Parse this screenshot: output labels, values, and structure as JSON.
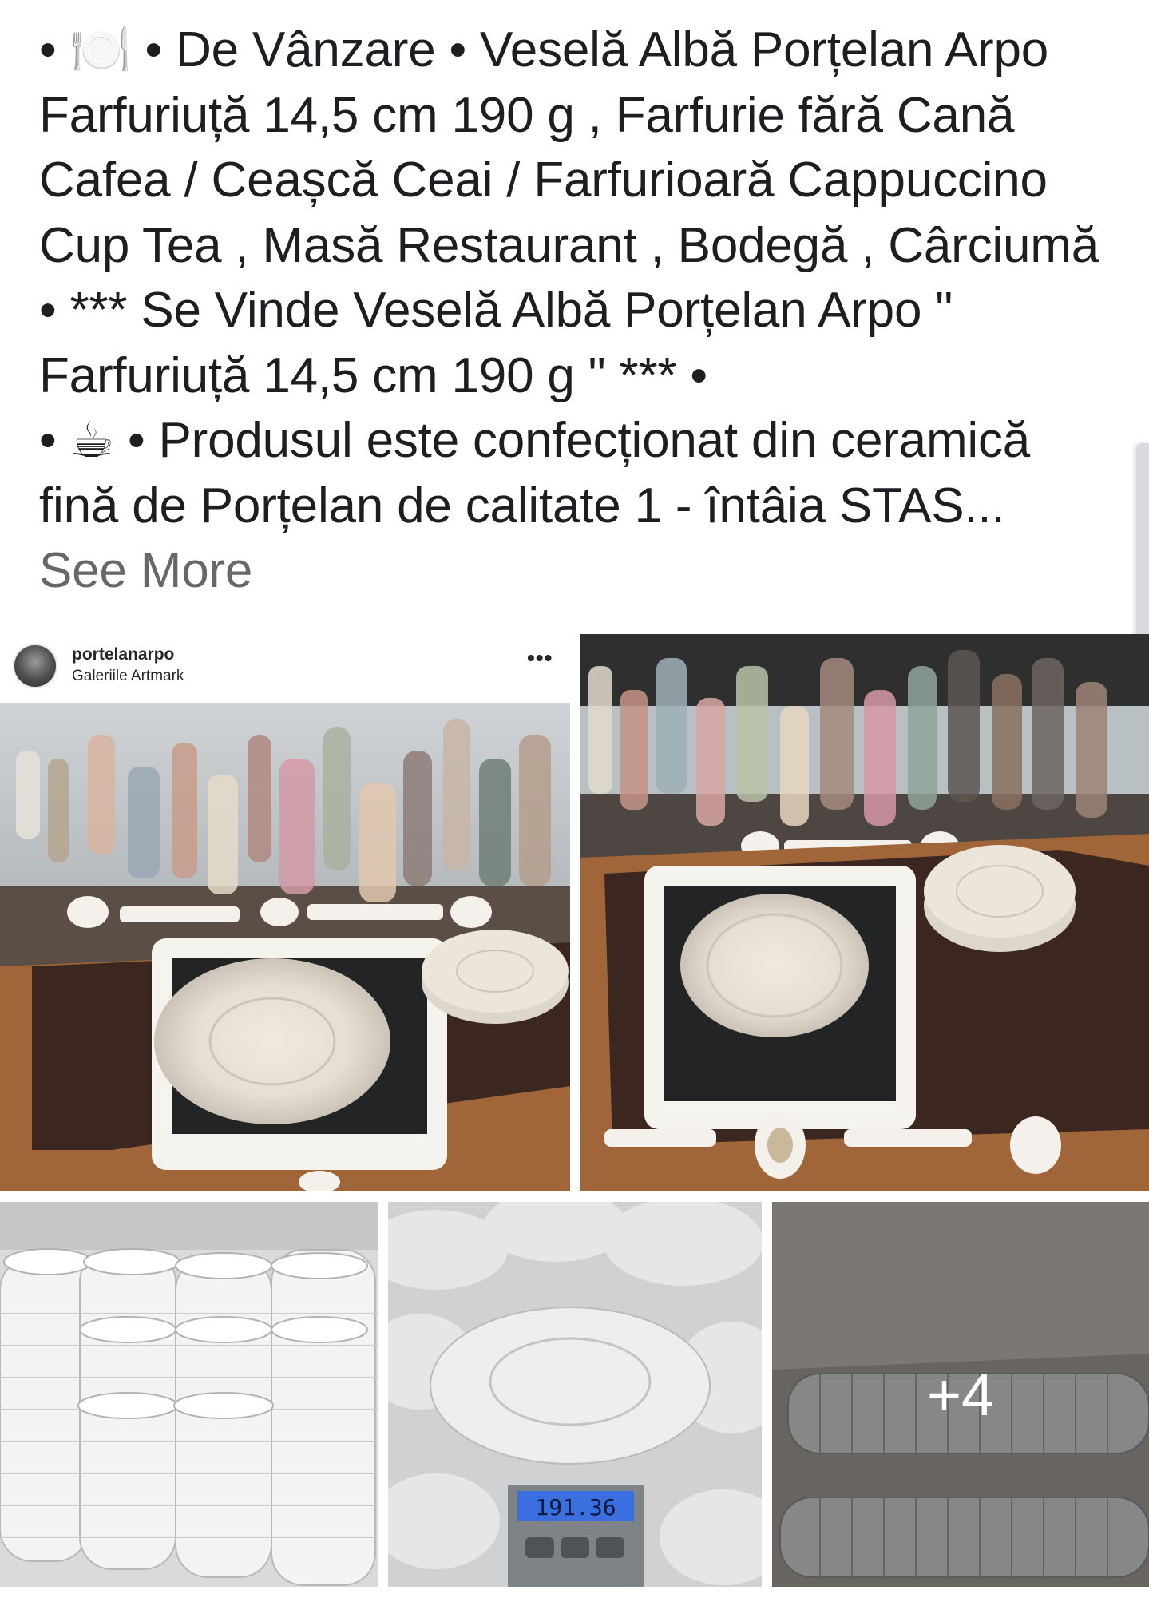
{
  "post": {
    "lines": [
      "• 🍽️ • De Vânzare • Veselă Albă Porțelan Arpo",
      "Farfuriuță 14,5 cm 190 g , Farfurie fără Cană",
      "Cafea / Ceașcă Ceai / Farfurioară Cappuccino",
      "Cup Tea , Masă Restaurant , Bodegă , Cârciumă",
      "• *** Se Vinde Veselă Albă Porțelan Arpo \"",
      "Farfuriuță 14,5 cm 190 g \" *** •",
      "• ☕ • Produsul este confecționat din ceramică",
      "fină de Porțelan de calitate 1 - întâia STAS..."
    ],
    "see_more": "See More"
  },
  "photos": {
    "instagram": {
      "username": "portelanarpo",
      "location": "Galeriile Artmark",
      "more_icon": "•••"
    },
    "scale_reading": "191.36",
    "more_count": "+4"
  },
  "colors": {
    "text": "#1c1e21",
    "see_more": "#65676b",
    "table_wood": "#a0663a",
    "placemat": "#3b2620"
  },
  "icons": [
    "plate-icon",
    "coffee-cup-icon",
    "more-options-icon"
  ]
}
